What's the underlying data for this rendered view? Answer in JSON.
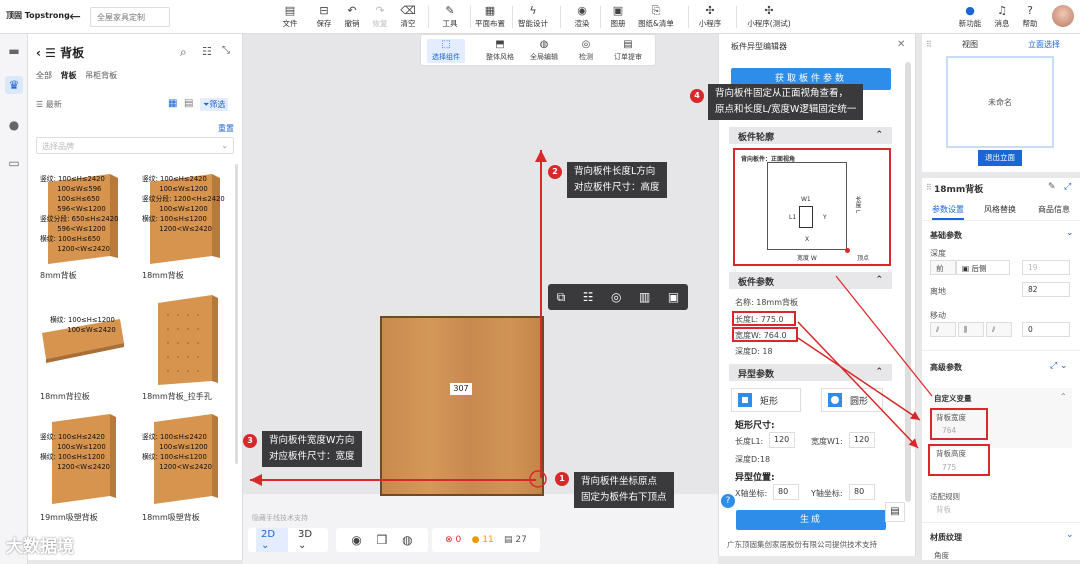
{
  "topbar": {
    "logo": "顶固 Topstrong",
    "project_name": "全屋家具定制",
    "tools": [
      {
        "label": "文件",
        "icon": "file-icon"
      },
      {
        "label": "保存",
        "icon": "save-icon"
      },
      {
        "label": "撤销",
        "icon": "undo-icon"
      },
      {
        "label": "恢复",
        "icon": "redo-icon",
        "disabled": true
      },
      {
        "label": "清空",
        "icon": "clear-icon"
      },
      {
        "label": "工具",
        "icon": "wrench-icon"
      },
      {
        "label": "平面布置",
        "icon": "floorplan-icon"
      },
      {
        "label": "智能设计",
        "icon": "lightning-icon"
      },
      {
        "label": "渲染",
        "icon": "render-icon"
      },
      {
        "label": "图册",
        "icon": "album-icon"
      },
      {
        "label": "图纸&清单",
        "icon": "drawing-icon"
      },
      {
        "label": "小程序",
        "icon": "miniapp-icon"
      },
      {
        "label": "小程序(测试)",
        "icon": "miniapp-test-icon"
      }
    ],
    "right": [
      {
        "label": "新功能",
        "icon": "new-feature-icon"
      },
      {
        "label": "消息",
        "icon": "bell-icon"
      },
      {
        "label": "帮助",
        "icon": "help-icon"
      }
    ]
  },
  "left_panel": {
    "title": "背板",
    "tabs": [
      "全部",
      "背板",
      "吊柜背板"
    ],
    "active_tab": "背板",
    "sort_label": "最新",
    "filter_label": "筛选",
    "reset_label": "重置",
    "brand_placeholder": "选择品牌",
    "products": [
      {
        "name": "8mm背板",
        "spec": "竖纹: 100≤H≤2420\n        100≤W≤596\n        100≤H≤650\n        596<W≤1200\n竖纹分段: 650≤H≤2420\n        596<W≤1200\n横纹: 100≤H≤650\n        1200<W≤2420"
      },
      {
        "name": "18mm背板",
        "spec": "竖纹: 100≤H≤2420\n        100≤W≤1200\n竖纹分段: 1200<H≤2420\n        100≤W≤1200\n横纹: 100≤H≤1200\n        1200<W≤2420"
      },
      {
        "name": "18mm背拉板",
        "spec": "横纹: 100≤H≤1200\n        100≤W≤2420"
      },
      {
        "name": "18mm背板_拉手孔",
        "spec": ""
      },
      {
        "name": "19mm吸塑背板",
        "spec": "竖纹: 100≤H≤2420\n        100≤W≤1200\n横纹: 100≤H≤1200\n        1200<W≤2420"
      },
      {
        "name": "18mm吸塑背板",
        "spec": "竖纹: 100≤H≤2420\n        100≤W≤1200\n横纹: 100≤H≤1200\n        1200<W≤2420"
      }
    ]
  },
  "floating_toolbar": [
    {
      "label": "选择组件",
      "icon": "select-icon",
      "active": true
    },
    {
      "label": "整体风格",
      "icon": "style-icon"
    },
    {
      "label": "全局编辑",
      "icon": "globe-icon"
    },
    {
      "label": "检测",
      "icon": "detect-icon"
    },
    {
      "label": "订单提审",
      "icon": "order-icon"
    }
  ],
  "canvas": {
    "board_dimension": "307",
    "hint_text": "隐藏手线技术支持"
  },
  "bottom_bar": {
    "view_2d": "2D",
    "view_3d": "3D",
    "error_count": "0",
    "warning_count": "11",
    "info_count": "27"
  },
  "editor": {
    "title": "板件异型编辑器",
    "get_button": "获取板件参数",
    "section_outline": "板件轮廓",
    "outline_caption": "背向板件：正面视角",
    "outline_w_label": "W1",
    "outline_l_label": "L1",
    "outline_y_label": "Y",
    "outline_x_label": "X",
    "outline_width_label": "宽度 W",
    "outline_length_label": "长度 L",
    "outline_origin_label": "顶点",
    "section_params": "板件参数",
    "name_label": "名称:",
    "name_value": "18mm背板",
    "length_label": "长度L:",
    "length_value": "775.0",
    "width_label": "宽度W:",
    "width_value": "764.0",
    "depth_label": "深度D:",
    "depth_value": "18",
    "section_shape": "异型参数",
    "shape_rect": "矩形",
    "shape_round": "圆形",
    "rect_size_title": "矩形尺寸:",
    "rect_l1_label": "长度L1:",
    "rect_l1_value": "120",
    "rect_w1_label": "宽度W1:",
    "rect_w1_value": "120",
    "rect_depth": "深度D:18",
    "pos_title": "异型位置:",
    "x_label": "X轴坐标:",
    "x_value": "80",
    "y_label": "Y轴坐标:",
    "y_value": "80",
    "generate_button": "生成",
    "credit": "广东顶固集创家居股份有限公司提供技术支持"
  },
  "right_top": {
    "tab_view": "视图",
    "tab_elev": "立面选择",
    "unnamed": "未命名",
    "exit_button": "退出立面"
  },
  "right_panel": {
    "title": "18mm背板",
    "tabs": [
      "参数设置",
      "风格替换",
      "商品信息"
    ],
    "basic_title": "基础参数",
    "depth_label": "深度",
    "depth_front": "前",
    "depth_back": "后侧",
    "depth_value": "19",
    "offset_label": "离地",
    "offset_value": "82",
    "move_label": "移动",
    "move_value": "0",
    "advanced_title": "高级参数",
    "custom_var_title": "自定义变量",
    "back_width_label": "背板宽度",
    "back_width_value": "764",
    "back_height_label": "背板高度",
    "back_height_value": "775",
    "fit_rule_label": "适配规则",
    "fit_rule_value": "背板",
    "material_title": "材质纹理",
    "angle_label": "角度"
  },
  "callouts": {
    "c1": "背向板件坐标原点\n固定为板件右下顶点",
    "c2": "背向板件长度L方向\n对应板件尺寸：高度",
    "c3": "背向板件宽度W方向\n对应板件尺寸：宽度",
    "c4": "背向板件固定从正面视角查看，\n原点和长度L/宽度W逻辑固定统一"
  },
  "watermark": "大数据境"
}
